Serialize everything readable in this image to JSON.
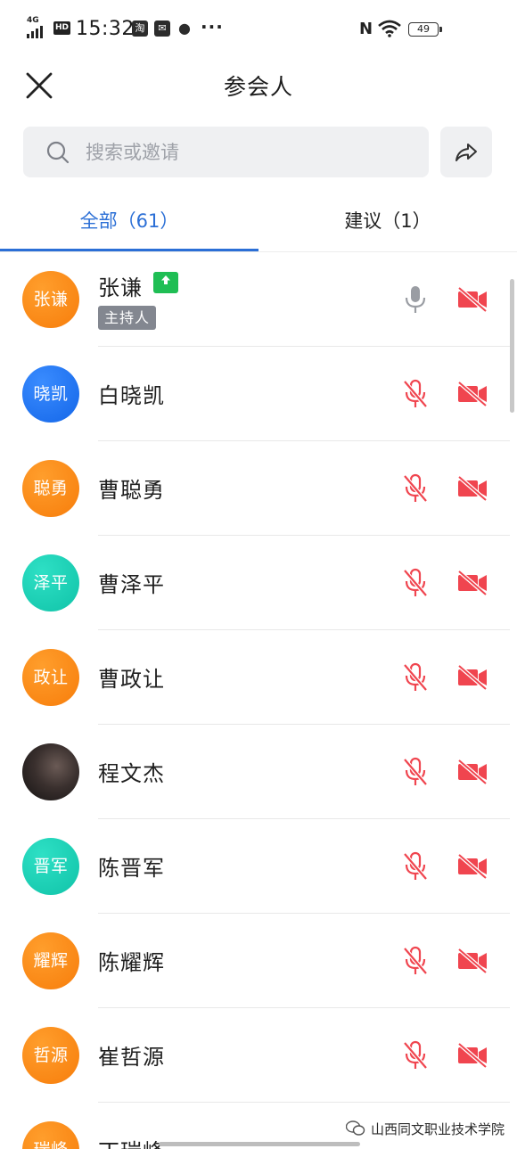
{
  "status_bar": {
    "network": "4G",
    "hd": "HD",
    "time": "15:32",
    "app_icons": [
      "淘",
      "✉",
      "●"
    ],
    "more": "···",
    "nfc": "N",
    "battery": "49"
  },
  "header": {
    "title": "参会人"
  },
  "search": {
    "placeholder": "搜索或邀请",
    "value": ""
  },
  "tabs": [
    {
      "label": "全部（61）",
      "active": true
    },
    {
      "label": "建议（1）",
      "active": false
    }
  ],
  "participants": [
    {
      "avatar_text": "张谦",
      "avatar_color": "orange",
      "name": "张谦",
      "host": true,
      "host_label": "主持人",
      "sharing": true,
      "mic": "on",
      "camera": "off"
    },
    {
      "avatar_text": "晓凯",
      "avatar_color": "blue",
      "name": "白晓凯",
      "mic": "muted",
      "camera": "off"
    },
    {
      "avatar_text": "聪勇",
      "avatar_color": "orange",
      "name": "曹聪勇",
      "mic": "muted",
      "camera": "off"
    },
    {
      "avatar_text": "泽平",
      "avatar_color": "teal",
      "name": "曹泽平",
      "mic": "muted",
      "camera": "off"
    },
    {
      "avatar_text": "政让",
      "avatar_color": "orange",
      "name": "曹政让",
      "mic": "muted",
      "camera": "off"
    },
    {
      "avatar_text": "",
      "avatar_color": "photo",
      "name": "程文杰",
      "mic": "muted",
      "camera": "off"
    },
    {
      "avatar_text": "晋军",
      "avatar_color": "teal",
      "name": "陈晋军",
      "mic": "muted",
      "camera": "off"
    },
    {
      "avatar_text": "耀辉",
      "avatar_color": "orange",
      "name": "陈耀辉",
      "mic": "muted",
      "camera": "off"
    },
    {
      "avatar_text": "哲源",
      "avatar_color": "orange",
      "name": "崔哲源",
      "mic": "muted",
      "camera": "off"
    },
    {
      "avatar_text": "瑞峰",
      "avatar_color": "orange",
      "name": "丁瑞峰",
      "mic": "muted",
      "camera": "off"
    }
  ],
  "colors": {
    "accent": "#2b6fd6",
    "muted_red": "#f0454f",
    "mic_on_gray": "#9a9da3",
    "share_green": "#1fbe54"
  },
  "watermark": "山西同文职业技术学院"
}
